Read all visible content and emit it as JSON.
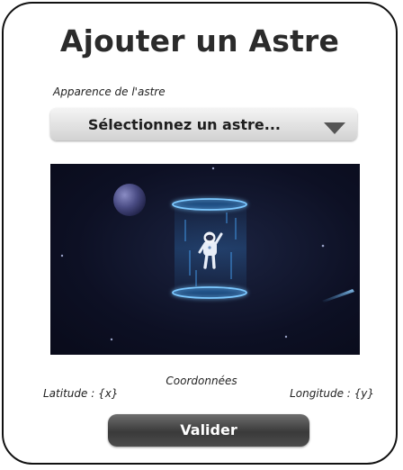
{
  "header": {
    "title": "Ajouter un Astre"
  },
  "appearance": {
    "label": "Apparence de l'astre",
    "selected_value": "Sélectionnez un astre...",
    "arrow_icon": "chevron-down-icon"
  },
  "preview": {
    "illustration": "astronaut-teleporter"
  },
  "coordinates": {
    "title": "Coordonnées",
    "latitude_label": "Latitude : {x}",
    "longitude_label": "Longitude : {y}"
  },
  "actions": {
    "submit_label": "Valider"
  },
  "colors": {
    "button": "#4a4a4a",
    "accent_glow": "#5fb6ff",
    "scene_bg": "#0d1024"
  }
}
